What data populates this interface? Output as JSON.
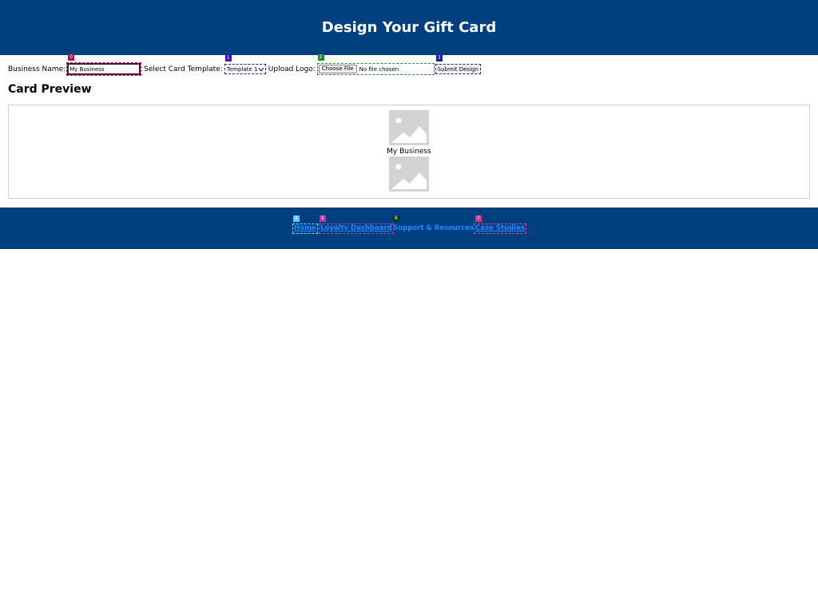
{
  "header": {
    "title": "Design Your Gift Card"
  },
  "form": {
    "business_name_label": "Business Name:",
    "business_name_value": "My Business",
    "template_label": "Select Card Template:",
    "template_value": "Template 1",
    "logo_label": "Upload Logo:",
    "file_button_label": "Choose File",
    "file_status": "No file chosen",
    "submit_label": "Submit Design"
  },
  "preview": {
    "title": "Card Preview",
    "business_name": "My Business",
    "top_image_icon": "image-placeholder-icon",
    "bottom_image_icon": "image-placeholder-icon"
  },
  "tags": [
    "0",
    "1",
    "2",
    "3",
    "4",
    "5",
    "6",
    "7"
  ],
  "footer": {
    "links": [
      {
        "label": "Home"
      },
      {
        "label": "Loyalty Dashboard"
      },
      {
        "label": "Support & Resources"
      },
      {
        "label": "Case Studies"
      }
    ]
  },
  "colors": {
    "brand": "#003f80",
    "link": "#1e88ff"
  }
}
